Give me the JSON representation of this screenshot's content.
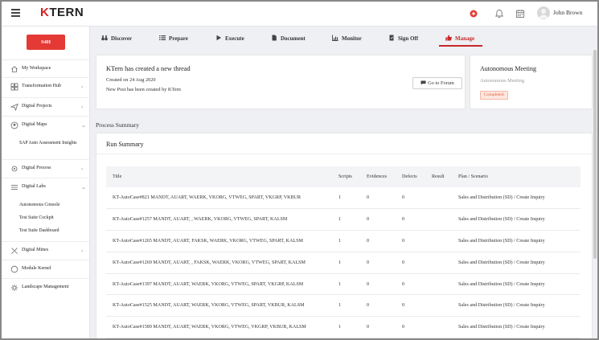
{
  "header": {
    "logo_accent": "K",
    "logo_rest": "TERN",
    "user_name": "John Brown"
  },
  "sidebar": {
    "badge": "S4H",
    "items": [
      {
        "label": "My Workspace",
        "icon": "home-icon",
        "chevron": ""
      },
      {
        "label": "Transformation Hub",
        "icon": "grid-icon",
        "chevron": "‹"
      },
      {
        "label": "Digital Projects",
        "icon": "paper-plane-icon",
        "chevron": "‹"
      },
      {
        "label": "Digital Maps",
        "icon": "map-icon",
        "chevron": "⌄"
      },
      {
        "label": "Digital Process",
        "icon": "process-icon",
        "chevron": "‹"
      },
      {
        "label": "Digital Labs",
        "icon": "labs-icon",
        "chevron": "⌄"
      },
      {
        "label": "Digital Mines",
        "icon": "mines-icon",
        "chevron": "‹"
      },
      {
        "label": "Module Kernel",
        "icon": "kernel-icon",
        "chevron": ""
      },
      {
        "label": "Landscape Management",
        "icon": "landscape-icon",
        "chevron": ""
      }
    ],
    "maps_sub": [
      "SAP Auto Assessment Insights"
    ],
    "labs_sub": [
      "Autonomous Console",
      "Test Suite Cockpit",
      "Test Suite Dashboard"
    ]
  },
  "nav": {
    "tabs": [
      {
        "label": "Discover",
        "icon": "binoculars-icon"
      },
      {
        "label": "Prepare",
        "icon": "list-icon"
      },
      {
        "label": "Execute",
        "icon": "play-icon"
      },
      {
        "label": "Document",
        "icon": "document-icon"
      },
      {
        "label": "Monitor",
        "icon": "chart-icon"
      },
      {
        "label": "Sign Off",
        "icon": "signoff-icon"
      },
      {
        "label": "Manage",
        "icon": "thumbs-up-icon"
      }
    ],
    "active": "Manage"
  },
  "thread": {
    "title": "KTern has created a new thread",
    "created": "Created on 24 Aug 2020",
    "subtitle": "New Post has been created by KTern",
    "button": "Go to Forum"
  },
  "meeting": {
    "title": "Autonomous Meeting",
    "subtitle": "Autonomous Meeting",
    "status": "Completed"
  },
  "process_summary": {
    "title": "Process Summary",
    "run_title": "Run Summary",
    "columns": [
      "Title",
      "Scripts",
      "Evidences",
      "Defects",
      "Result",
      "Plan / Scenario"
    ],
    "rows": [
      [
        "KT-AutoCase#821 MANDT, AUART, WAERK, VKORG, VTWEG, SPART, VKGRP, VKBUR",
        "1",
        "0",
        "0",
        "",
        "Sales and Distribution (SD) / Create Inquiry"
      ],
      [
        "KT-AutoCase#1257 MANDT, AUART, , WAERK, VKORG, VTWEG, SPART, KALSM",
        "1",
        "0",
        "0",
        "",
        "Sales and Distribution (SD) / Create Inquiry"
      ],
      [
        "KT-AutoCase#1265 MANDT, AUART, FAKSK, WAERK, VKORG, VTWEG, SPART, KALSM",
        "1",
        "0",
        "0",
        "",
        "Sales and Distribution (SD) / Create Inquiry"
      ],
      [
        "KT-AutoCase#1269 MANDT, AUART, , FAKSK, WAERK, VKORG, VTWEG, SPART, KALSM",
        "1",
        "0",
        "0",
        "",
        "Sales and Distribution (SD) / Create Inquiry"
      ],
      [
        "KT-AutoCase#1397 MANDT, AUART, WAERK, VKORG, VTWEG, SPART, VKGRP, KALSM",
        "1",
        "0",
        "0",
        "",
        "Sales and Distribution (SD) / Create Inquiry"
      ],
      [
        "KT-AutoCase#1525 MANDT, AUART, WAERK, VKORG, VTWEG, SPART, VKBUR, KALSM",
        "1",
        "0",
        "0",
        "",
        "Sales and Distribution (SD) / Create Inquiry"
      ],
      [
        "KT-AutoCase#1589 MANDT, AUART, WAERK, VKORG, VTWEG, VKGRP, VKBUR, KALSM",
        "1",
        "0",
        "0",
        "",
        "Sales and Distribution (SD) / Create Inquiry"
      ]
    ]
  },
  "colors": {
    "accent": "#c62828",
    "badge_red": "#e53935",
    "completed_text": "#e2613b"
  }
}
